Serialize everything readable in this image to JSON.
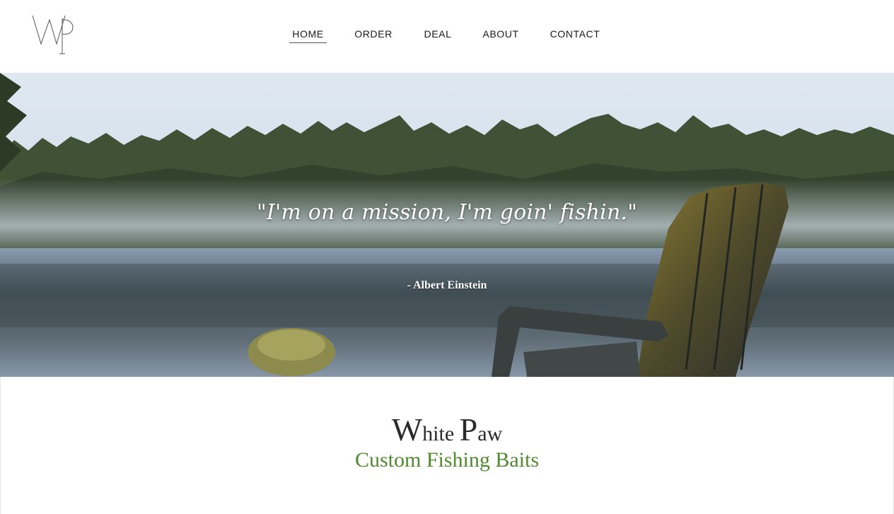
{
  "logo": {
    "text": "WP"
  },
  "nav": {
    "items": [
      {
        "label": "HOME",
        "active": true
      },
      {
        "label": "ORDER",
        "active": false
      },
      {
        "label": "DEAL",
        "active": false
      },
      {
        "label": "ABOUT",
        "active": false
      },
      {
        "label": "CONTACT",
        "active": false
      }
    ]
  },
  "hero": {
    "quote": "\"I'm on a mission, I'm goin' fishin.\"",
    "author": "- Albert Einstein"
  },
  "brand": {
    "w_cap": "W",
    "w_rest": "hite",
    "p_cap": "P",
    "p_rest": "aw",
    "tagline": "Custom Fishing Baits"
  },
  "colors": {
    "tagline": "#4f8a2f",
    "text": "#1a1a1a"
  }
}
